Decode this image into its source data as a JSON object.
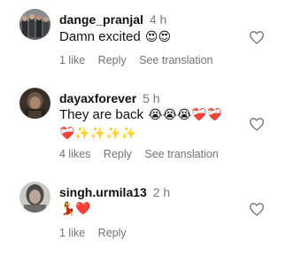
{
  "comments": [
    {
      "username": "dange_pranjal",
      "time": "4 h",
      "text": "Damn excited",
      "emojis": "😍😍",
      "emojis_line2": "",
      "likes": "1 like",
      "reply": "Reply",
      "translation": "See translation"
    },
    {
      "username": "dayaxforever",
      "time": "5 h",
      "text": "They are back",
      "emojis": "😭😭😭❤️‍🩹❤️‍🩹",
      "emojis_line2": "❤️‍🩹✨✨✨✨",
      "likes": "4 likes",
      "reply": "Reply",
      "translation": "See translation"
    },
    {
      "username": "singh.urmila13",
      "time": "2 h",
      "text": "",
      "emojis": "💃❤️",
      "emojis_line2": "",
      "likes": "1 like",
      "reply": "Reply",
      "translation": ""
    }
  ],
  "icons": {
    "like": "heart-outline-icon"
  },
  "colors": {
    "secondary_text": "#737373",
    "primary_text": "#111111"
  }
}
